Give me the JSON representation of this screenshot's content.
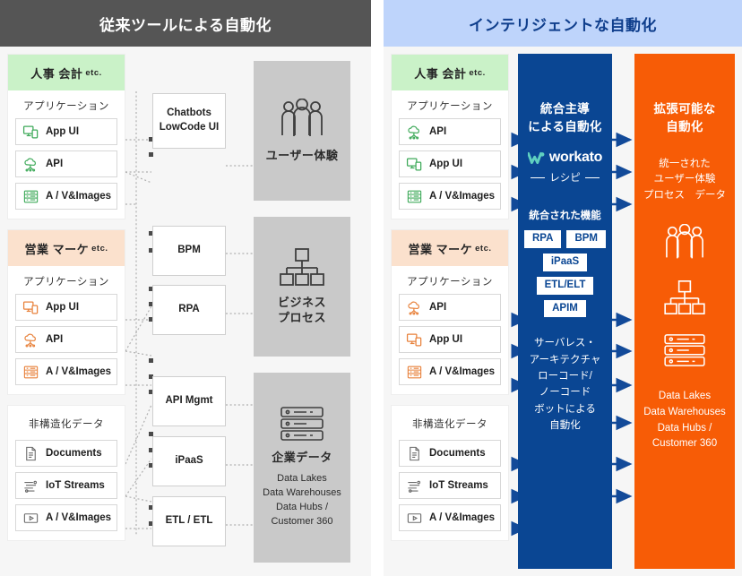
{
  "left_panel": {
    "header": "従来ツールによる自動化",
    "header_bg": "#555555",
    "groups": [
      {
        "title": "人事 会計",
        "title_suffix": "etc.",
        "color": "#caf2c8",
        "subtitle": "アプリケーション",
        "items": [
          {
            "label": "App UI",
            "icon": "app-ui-icon",
            "color": "#3faa5a"
          },
          {
            "label": "API",
            "icon": "api-cloud-icon",
            "color": "#3faa5a"
          },
          {
            "label": "A / V&Images",
            "icon": "media-server-icon",
            "color": "#3faa5a"
          }
        ]
      },
      {
        "title": "営業 マーケ",
        "title_suffix": "etc.",
        "color": "#fbe1cd",
        "subtitle": "アプリケーション",
        "items": [
          {
            "label": "App UI",
            "icon": "app-ui-icon",
            "color": "#e8823c"
          },
          {
            "label": "API",
            "icon": "api-cloud-icon",
            "color": "#e8823c"
          },
          {
            "label": "A / V&Images",
            "icon": "media-server-icon",
            "color": "#e8823c"
          }
        ]
      },
      {
        "title": "非構造化データ",
        "title_suffix": "",
        "color": "#ffffff",
        "subtitle": "",
        "items": [
          {
            "label": "Documents",
            "icon": "document-icon",
            "color": "#6b6b6b"
          },
          {
            "label": "IoT Streams",
            "icon": "iot-streams-icon",
            "color": "#6b6b6b"
          },
          {
            "label": "A / V&Images",
            "icon": "video-icon",
            "color": "#6b6b6b"
          }
        ]
      }
    ],
    "tools": [
      {
        "lines": [
          "Chatbots",
          "LowCode UI"
        ]
      },
      {
        "lines": [
          "BPM"
        ]
      },
      {
        "lines": [
          "RPA"
        ]
      },
      {
        "lines": [
          "API Mgmt"
        ]
      },
      {
        "lines": [
          "iPaaS"
        ]
      },
      {
        "lines": [
          "ETL / ETL"
        ]
      }
    ],
    "outcomes": [
      {
        "icon": "people-icon",
        "title_lines": [
          "ユーザー体験"
        ],
        "sub_lines": []
      },
      {
        "icon": "hierarchy-icon",
        "title_lines": [
          "ビジネス",
          "プロセス"
        ],
        "sub_lines": []
      },
      {
        "icon": "database-icon",
        "title_lines": [
          "企業データ"
        ],
        "sub_lines": [
          "Data Lakes",
          "Data Warehouses",
          "Data Hubs /",
          "Customer 360"
        ]
      }
    ]
  },
  "right_panel": {
    "header": "インテリジェントな自動化",
    "header_bg": "#bed4fb",
    "header_color": "#0f3e8c",
    "groups": [
      {
        "title": "人事 会計",
        "title_suffix": "etc.",
        "color": "#caf2c8",
        "subtitle": "アプリケーション",
        "items": [
          {
            "label": "API",
            "icon": "api-cloud-icon",
            "color": "#3faa5a"
          },
          {
            "label": "App UI",
            "icon": "app-ui-icon",
            "color": "#3faa5a"
          },
          {
            "label": "A / V&Images",
            "icon": "media-server-icon",
            "color": "#3faa5a"
          }
        ]
      },
      {
        "title": "営業 マーケ",
        "title_suffix": "etc.",
        "color": "#fbe1cd",
        "subtitle": "アプリケーション",
        "items": [
          {
            "label": "API",
            "icon": "api-cloud-icon",
            "color": "#e8823c"
          },
          {
            "label": "App UI",
            "icon": "app-ui-icon",
            "color": "#e8823c"
          },
          {
            "label": "A / V&Images",
            "icon": "media-server-icon",
            "color": "#e8823c"
          }
        ]
      },
      {
        "title": "非構造化データ",
        "title_suffix": "",
        "color": "#ffffff",
        "subtitle": "",
        "items": [
          {
            "label": "Documents",
            "icon": "document-icon",
            "color": "#6b6b6b"
          },
          {
            "label": "IoT Streams",
            "icon": "iot-streams-icon",
            "color": "#6b6b6b"
          },
          {
            "label": "A / V&Images",
            "icon": "video-icon",
            "color": "#6b6b6b"
          }
        ]
      }
    ],
    "blue_column": {
      "bg": "#0a4693",
      "title_lines": [
        "統合主導",
        "による自動化"
      ],
      "brand": "workato",
      "recipe": "レシピ",
      "features_label": "統合された機能",
      "chips": [
        [
          "RPA",
          "BPM"
        ],
        [
          "iPaaS"
        ],
        [
          "ETL/ELT"
        ],
        [
          "APIM"
        ]
      ],
      "footer_lines": [
        "サーバレス・",
        "アーキテクチャ",
        "ローコード/",
        "ノーコード",
        "ボットによる",
        "自動化"
      ]
    },
    "orange_column": {
      "bg": "#f75c06",
      "title_lines": [
        "拡張可能な",
        "自動化"
      ],
      "sub_lines": [
        "統一された",
        "ユーザー体験",
        "プロセス　データ"
      ],
      "icons": [
        "people-icon",
        "hierarchy-icon",
        "database-icon"
      ],
      "footer_lines": [
        "Data Lakes",
        "Data Warehouses",
        "Data Hubs /",
        "Customer 360"
      ]
    }
  }
}
